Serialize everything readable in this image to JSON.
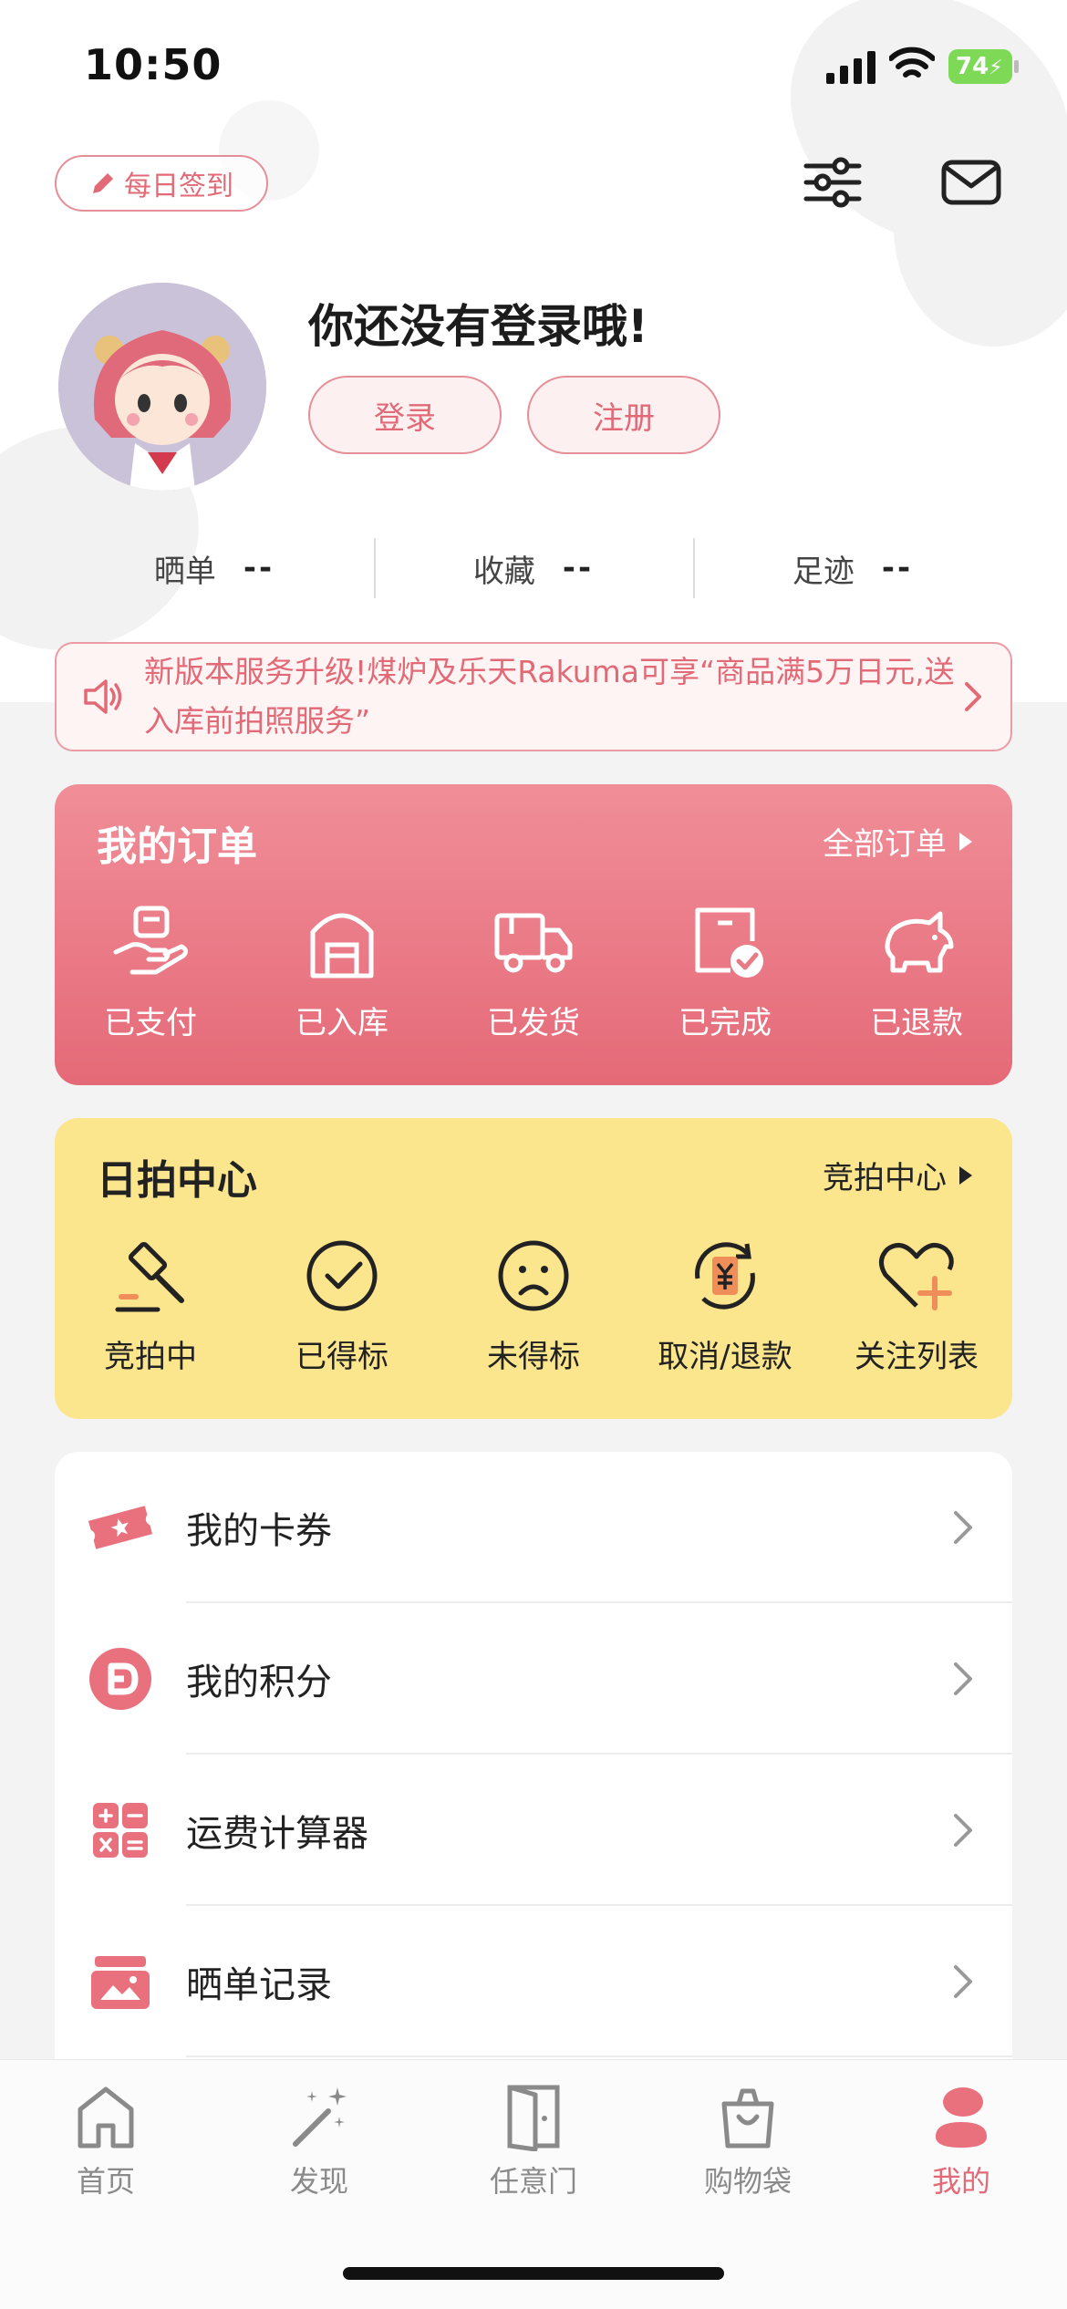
{
  "status_bar": {
    "time": "10:50",
    "battery": "74"
  },
  "header": {
    "checkin_label": "每日签到",
    "settings_icon": "sliders-icon",
    "mail_icon": "mail-icon"
  },
  "profile": {
    "title": "你还没有登录哦!",
    "login_label": "登录",
    "register_label": "注册"
  },
  "stats": [
    {
      "label": "晒单",
      "value": "--"
    },
    {
      "label": "收藏",
      "value": "--"
    },
    {
      "label": "足迹",
      "value": "--"
    }
  ],
  "notice": {
    "text": "新版本服务升级!煤炉及乐天Rakuma可享“商品满5万日元,送入库前拍照服务”"
  },
  "orders": {
    "title": "我的订单",
    "link": "全部订单",
    "items": [
      {
        "label": "已支付",
        "icon": "paid-hand-icon"
      },
      {
        "label": "已入库",
        "icon": "warehouse-icon"
      },
      {
        "label": "已发货",
        "icon": "truck-icon"
      },
      {
        "label": "已完成",
        "icon": "completed-box-icon"
      },
      {
        "label": "已退款",
        "icon": "piggy-bank-icon"
      }
    ]
  },
  "auction": {
    "title": "日拍中心",
    "link": "竞拍中心",
    "items": [
      {
        "label": "竞拍中",
        "icon": "gavel-icon"
      },
      {
        "label": "已得标",
        "icon": "check-circle-icon"
      },
      {
        "label": "未得标",
        "icon": "sad-face-icon"
      },
      {
        "label": "取消/退款",
        "icon": "refund-yen-icon"
      },
      {
        "label": "关注列表",
        "icon": "heart-plus-icon"
      }
    ]
  },
  "menu": [
    {
      "label": "我的卡券",
      "icon": "coupon-icon"
    },
    {
      "label": "我的积分",
      "icon": "points-icon"
    },
    {
      "label": "运费计算器",
      "icon": "calculator-icon"
    },
    {
      "label": "晒单记录",
      "icon": "photo-record-icon"
    }
  ],
  "tabs": [
    {
      "label": "首页",
      "icon": "home-icon"
    },
    {
      "label": "发现",
      "icon": "magic-wand-icon"
    },
    {
      "label": "任意门",
      "icon": "door-icon"
    },
    {
      "label": "购物袋",
      "icon": "shopping-bag-icon"
    },
    {
      "label": "我的",
      "icon": "profile-icon",
      "active": true
    }
  ],
  "colors": {
    "accent": "#e26a77",
    "orders_bg": "#e97b87",
    "auction_bg": "#fbe58d"
  }
}
